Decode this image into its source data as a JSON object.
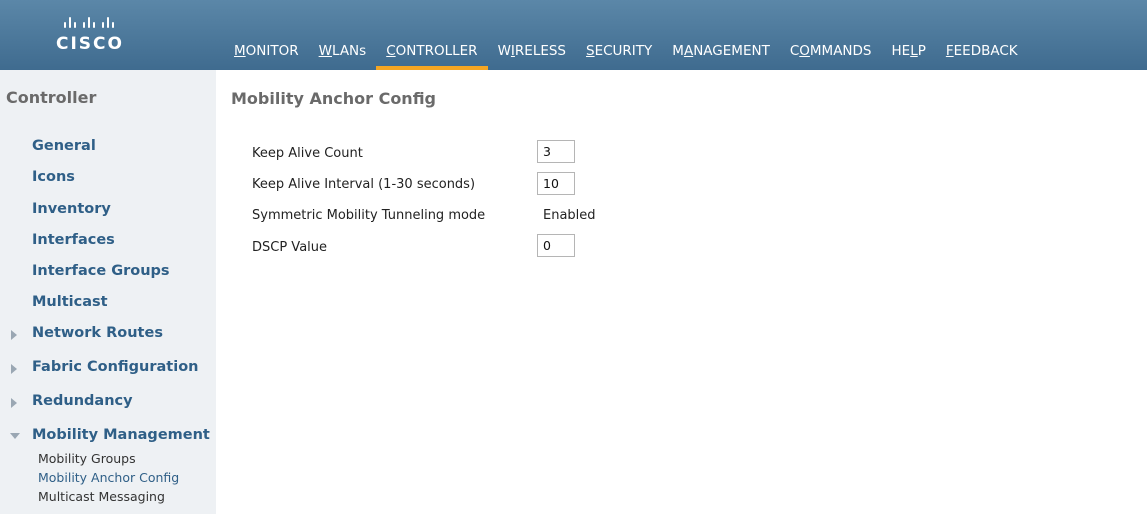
{
  "brand": {
    "name": "CISCO"
  },
  "nav": {
    "items": [
      {
        "pre": "",
        "u": "M",
        "post": "ONITOR"
      },
      {
        "pre": "",
        "u": "W",
        "post": "LANs"
      },
      {
        "pre": "",
        "u": "C",
        "post": "ONTROLLER"
      },
      {
        "pre": "W",
        "u": "I",
        "post": "RELESS"
      },
      {
        "pre": "",
        "u": "S",
        "post": "ECURITY"
      },
      {
        "pre": "M",
        "u": "A",
        "post": "NAGEMENT"
      },
      {
        "pre": "C",
        "u": "O",
        "post": "MMANDS"
      },
      {
        "pre": "HE",
        "u": "L",
        "post": "P"
      },
      {
        "pre": "",
        "u": "F",
        "post": "EEDBACK"
      }
    ],
    "active": "CONTROLLER"
  },
  "sidebar": {
    "title": "Controller",
    "items": [
      {
        "label": "General"
      },
      {
        "label": "Icons"
      },
      {
        "label": "Inventory"
      },
      {
        "label": "Interfaces"
      },
      {
        "label": "Interface Groups"
      },
      {
        "label": "Multicast"
      },
      {
        "label": "Network Routes",
        "expandable": true
      },
      {
        "label": "Fabric Configuration",
        "expandable": true
      },
      {
        "label": "Redundancy",
        "expandable": true
      },
      {
        "label": "Mobility Management",
        "expanded": true
      }
    ],
    "subitems": [
      {
        "label": "Mobility Groups"
      },
      {
        "label": "Mobility Anchor Config",
        "selected": true
      },
      {
        "label": "Multicast Messaging"
      }
    ]
  },
  "main": {
    "title": "Mobility Anchor Config",
    "rows": [
      {
        "label": "Keep Alive Count",
        "value": "3"
      },
      {
        "label": "Keep Alive Interval  (1-30 seconds)",
        "value": "10"
      },
      {
        "label": "Symmetric Mobility Tunneling mode",
        "value": "Enabled"
      },
      {
        "label": "DSCP Value",
        "value": "0"
      }
    ]
  }
}
